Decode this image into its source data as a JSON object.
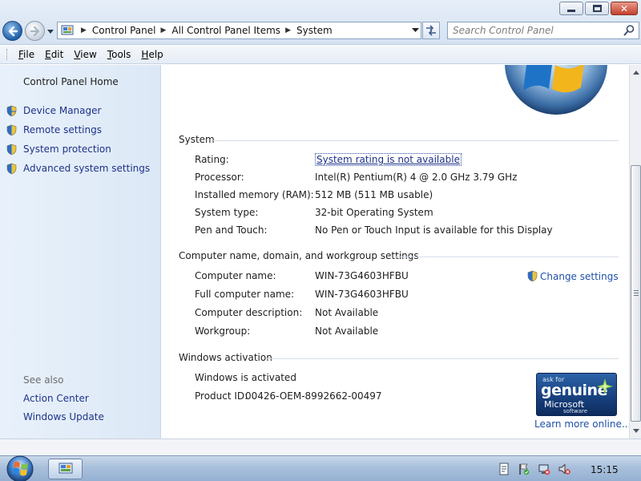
{
  "window": {
    "breadcrumbs": [
      "Control Panel",
      "All Control Panel Items",
      "System"
    ],
    "search_placeholder": "Search Control Panel"
  },
  "menu": {
    "items": [
      {
        "label": "File",
        "accel": "F",
        "rest": "ile"
      },
      {
        "label": "Edit",
        "accel": "E",
        "rest": "dit"
      },
      {
        "label": "View",
        "accel": "V",
        "rest": "iew"
      },
      {
        "label": "Tools",
        "accel": "T",
        "rest": "ools"
      },
      {
        "label": "Help",
        "accel": "H",
        "rest": "elp"
      }
    ]
  },
  "sidebar": {
    "home": "Control Panel Home",
    "tasks": [
      "Device Manager",
      "Remote settings",
      "System protection",
      "Advanced system settings"
    ],
    "see_also_title": "See also",
    "see_also": [
      "Action Center",
      "Windows Update"
    ]
  },
  "system": {
    "title": "System",
    "rating_label": "Rating:",
    "rating_value": "System rating is not available",
    "processor_label": "Processor:",
    "processor_value": "Intel(R) Pentium(R) 4   @ 2.0 GHz   3.79 GHz",
    "memory_label": "Installed memory (RAM):",
    "memory_value": "512 MB (511 MB usable)",
    "type_label": "System type:",
    "type_value": "32-bit Operating System",
    "pen_label": "Pen and Touch:",
    "pen_value": "No Pen or Touch Input is available for this Display"
  },
  "computer": {
    "title": "Computer name, domain, and workgroup settings",
    "name_label": "Computer name:",
    "name_value": "WIN-73G4603HFBU",
    "full_label": "Full computer name:",
    "full_value": "WIN-73G4603HFBU",
    "desc_label": "Computer description:",
    "desc_value": "Not Available",
    "workgroup_label": "Workgroup:",
    "workgroup_value": "Not Available",
    "change_settings": "Change settings"
  },
  "activation": {
    "title": "Windows activation",
    "status": "Windows is activated",
    "product_id_label": "Product ID:",
    "product_id_value": "00426-OEM-8992662-00497",
    "badge_line1": "ask for",
    "badge_line2": "genuine",
    "badge_line3": "Microsoft",
    "badge_line4": "software",
    "learn_more": "Learn more online..."
  },
  "taskbar": {
    "clock": "15:15"
  },
  "colors": {
    "link": "#1e3287",
    "accent_link": "#1e50a8",
    "sidebar_bg": "#e4eef9"
  }
}
